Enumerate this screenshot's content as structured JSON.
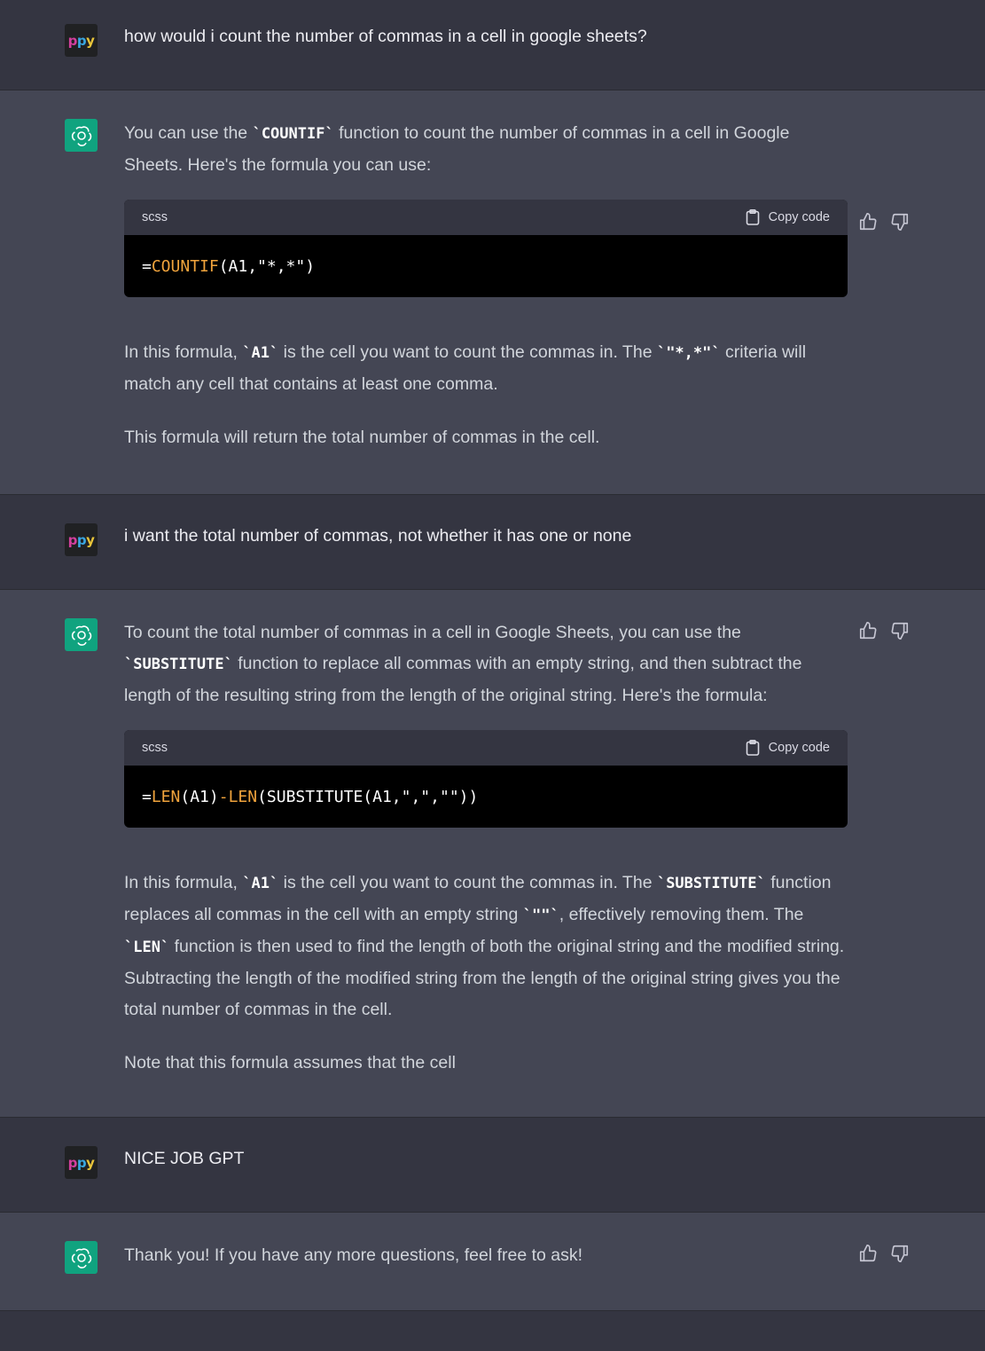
{
  "avatar_user": {
    "l1": "p",
    "l2": "p",
    "l3": "y"
  },
  "turns": [
    {
      "question": "how would i count the number of commas in a cell in google sheets?"
    },
    {
      "p1_a": "You can use the ",
      "p1_code": "`COUNTIF`",
      "p1_b": " function to count the number of commas in a cell in Google Sheets. Here's the formula you can use:",
      "code_lang": "scss",
      "copy_label": "Copy code",
      "code_eq": "=",
      "code_fn": "COUNTIF",
      "code_rest": "(A1,\"*,*\")",
      "p2_a": "In this formula, ",
      "p2_code1": "`A1`",
      "p2_b": " is the cell you want to count the commas in. The ",
      "p2_code2": "`\"*,*\"`",
      "p2_c": " criteria will match any cell that contains at least one comma.",
      "p3": "This formula will return the total number of commas in the cell."
    },
    {
      "question": "i want the total number of commas, not whether it has one or none"
    },
    {
      "p1_a": "To count the total number of commas in a cell in Google Sheets, you can use the ",
      "p1_code": "`SUBSTITUTE`",
      "p1_b": " function to replace all commas with an empty string, and then subtract the length of the resulting string from the length of the original string. Here's the formula:",
      "code_lang": "scss",
      "copy_label": "Copy code",
      "code_eq": "=",
      "code_fn1": "LEN",
      "code_mid": "(A1)",
      "code_dash": "-",
      "code_fn2": "LEN",
      "code_rest": "(SUBSTITUTE(A1,\",\",\"\"))",
      "p2_a": "In this formula, ",
      "p2_code1": "`A1`",
      "p2_b": " is the cell you want to count the commas in. The ",
      "p2_code2": "`SUBSTITUTE`",
      "p2_c": " function replaces all commas in the cell with an empty string ",
      "p2_code3": "`\"\"`",
      "p2_d": ", effectively removing them. The ",
      "p2_code4": "`LEN`",
      "p2_e": " function is then used to find the length of both the original string and the modified string. Subtracting the length of the modified string from the length of the original string gives you the total number of commas in the cell.",
      "p3": "Note that this formula assumes that the cell"
    },
    {
      "question": "NICE JOB GPT"
    },
    {
      "answer": "Thank you! If you have any more questions, feel free to ask!"
    }
  ],
  "colors": {
    "bg_user": "#343541",
    "bg_bot": "#444654",
    "accent": "#10a37f",
    "code_fn": "#f0a33c"
  }
}
